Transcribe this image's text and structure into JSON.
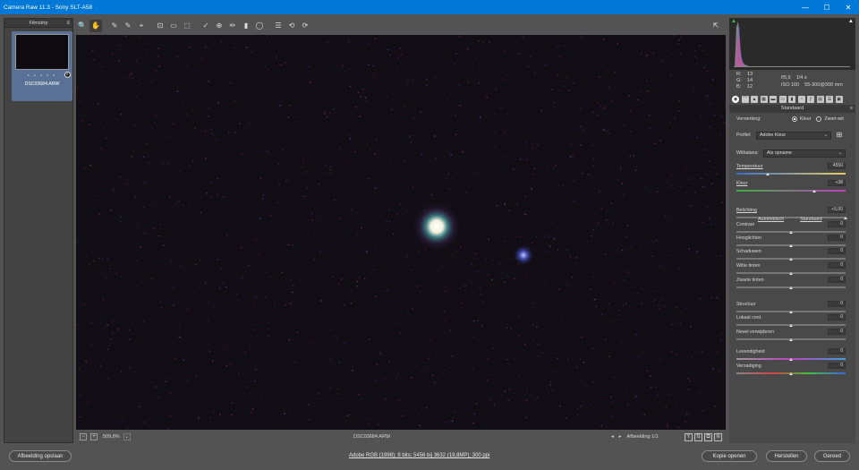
{
  "window": {
    "title": "Camera Raw 11.3  -  Sony SLT-A58",
    "min": "—",
    "max": "☐",
    "close": "✕"
  },
  "filmstrip": {
    "title": "Filmstrip",
    "stars": "• • • • •",
    "filename": "DSC03684.ARW"
  },
  "toolbar": {
    "tools": [
      "zoom-icon",
      "hand-icon",
      "white-balance-icon",
      "color-sampler-icon",
      "target-adjust-icon",
      "crop-icon",
      "straighten-icon",
      "transform-icon",
      "spot-removal-icon",
      "red-eye-icon",
      "adjustment-brush-icon",
      "graduated-filter-icon",
      "radial-filter-icon",
      "preferences-icon",
      "rotate-left-icon",
      "rotate-right-icon"
    ],
    "glyphs": [
      "🔍",
      "✋",
      "✎",
      "✎",
      "⌖",
      "⊡",
      "▭",
      "⬚",
      "✓",
      "⊕",
      "✏",
      "▮",
      "◯",
      "☰",
      "⟲",
      "⟳"
    ]
  },
  "status": {
    "zoom": "509,8%",
    "filename": "DSC03684.ARW",
    "image_count": "Afbeelding 1/1",
    "prev": "◂",
    "next": "▸"
  },
  "bottom": {
    "save_label": "Afbeelding opslaan",
    "info": "Adobe RGB (1998); 8 bits; 5456 bij 3632 (19,8MP); 300 ppi",
    "open_copy": "Kopie openen",
    "reset": "Herstellen",
    "done": "Gereed"
  },
  "camera_info": {
    "r_label": "R:",
    "r": "13",
    "g_label": "G:",
    "g": "14",
    "b_label": "B:",
    "b": "12",
    "aperture": "f/5,6",
    "shutter": "1/4 s",
    "iso": "ISO 100",
    "lens": "55-300@300 mm"
  },
  "panel": {
    "section_title": "Standaard",
    "processing_label": "Verwerking:",
    "color_option": "Kleur",
    "bw_option": "Zwart-wit",
    "profile_label": "Profiel:",
    "profile_value": "Adobe Kleur",
    "wb_label": "Witbalans:",
    "wb_value": "Als opname",
    "auto_link": "Automatisch",
    "default_link": "Standaard"
  },
  "sliders": [
    {
      "name": "Temperatuur",
      "value": "4550",
      "pos": 0.29,
      "ul": true
    },
    {
      "name": "Kleur",
      "value": "+38",
      "pos": 0.71,
      "ul": true
    },
    {
      "name": "Belichting",
      "value": "+5,00",
      "pos": 1.0,
      "ul": true
    },
    {
      "name": "Contrast",
      "value": "0",
      "pos": 0.5,
      "ul": false
    },
    {
      "name": "Hooglichten",
      "value": "0",
      "pos": 0.5,
      "ul": false
    },
    {
      "name": "Schaduwen",
      "value": "0",
      "pos": 0.5,
      "ul": false
    },
    {
      "name": "Witte tinten",
      "value": "0",
      "pos": 0.5,
      "ul": false
    },
    {
      "name": "Zwarte tinten",
      "value": "0",
      "pos": 0.5,
      "ul": false
    },
    {
      "name": "Structuur",
      "value": "0",
      "pos": 0.5,
      "ul": false
    },
    {
      "name": "Lokaal cont.",
      "value": "0",
      "pos": 0.5,
      "ul": false
    },
    {
      "name": "Nevel verwijderen",
      "value": "0",
      "pos": 0.5,
      "ul": false
    },
    {
      "name": "Levendigheid",
      "value": "0",
      "pos": 0.5,
      "ul": false
    },
    {
      "name": "Verzadiging",
      "value": "0",
      "pos": 0.5,
      "ul": false
    }
  ]
}
